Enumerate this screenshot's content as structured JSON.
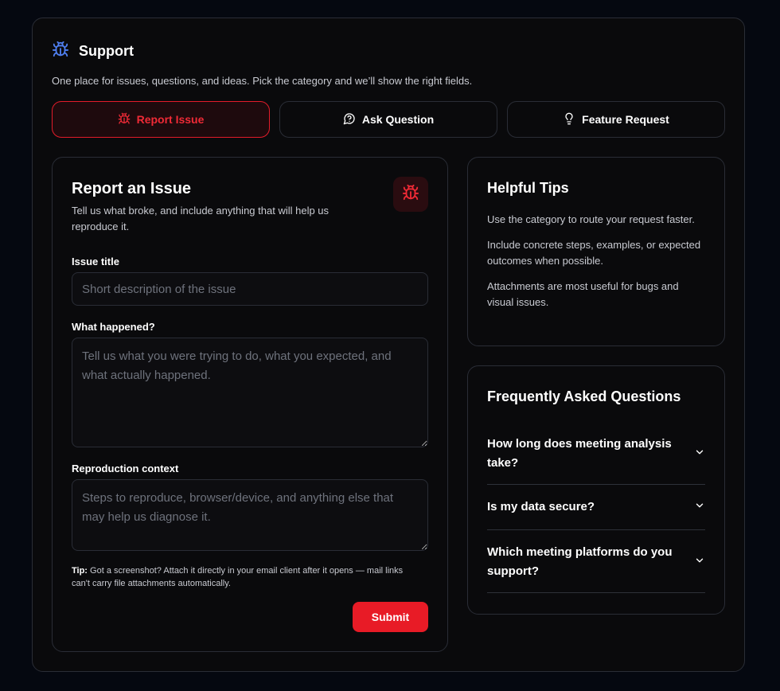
{
  "header": {
    "title": "Support",
    "subtitle": "One place for issues, questions, and ideas. Pick the category and we’ll show the right fields."
  },
  "tabs": [
    {
      "label": "Report Issue",
      "icon": "bug-icon",
      "active": true
    },
    {
      "label": "Ask Question",
      "icon": "chat-bubble-icon",
      "active": false
    },
    {
      "label": "Feature Request",
      "icon": "lightbulb-icon",
      "active": false
    }
  ],
  "form": {
    "title": "Report an Issue",
    "description": "Tell us what broke, and include anything that will help us reproduce it.",
    "fields": {
      "issue_title": {
        "label": "Issue title",
        "placeholder": "Short description of the issue",
        "value": ""
      },
      "what_happened": {
        "label": "What happened?",
        "placeholder": "Tell us what you were trying to do, what you expected, and what actually happened.",
        "value": ""
      },
      "repro_context": {
        "label": "Reproduction context",
        "placeholder": "Steps to reproduce, browser/device, and anything else that may help us diagnose it.",
        "value": ""
      }
    },
    "tip_label": "Tip:",
    "tip_text": "Got a screenshot? Attach it directly in your email client after it opens — mail links can't carry file attachments automatically.",
    "submit_label": "Submit"
  },
  "tips": {
    "title": "Helpful Tips",
    "items": [
      "Use the category to route your request faster.",
      "Include concrete steps, examples, or expected outcomes when possible.",
      "Attachments are most useful for bugs and visual issues."
    ]
  },
  "faq": {
    "title": "Frequently Asked Questions",
    "items": [
      {
        "question": "How long does meeting analysis take?"
      },
      {
        "question": "Is my data secure?"
      },
      {
        "question": "Which meeting platforms do you support?"
      }
    ]
  },
  "colors": {
    "accent": "#e81b26",
    "header_icon": "#4f7ff0",
    "background": "#0a0a0c",
    "border": "#2a2d36"
  }
}
